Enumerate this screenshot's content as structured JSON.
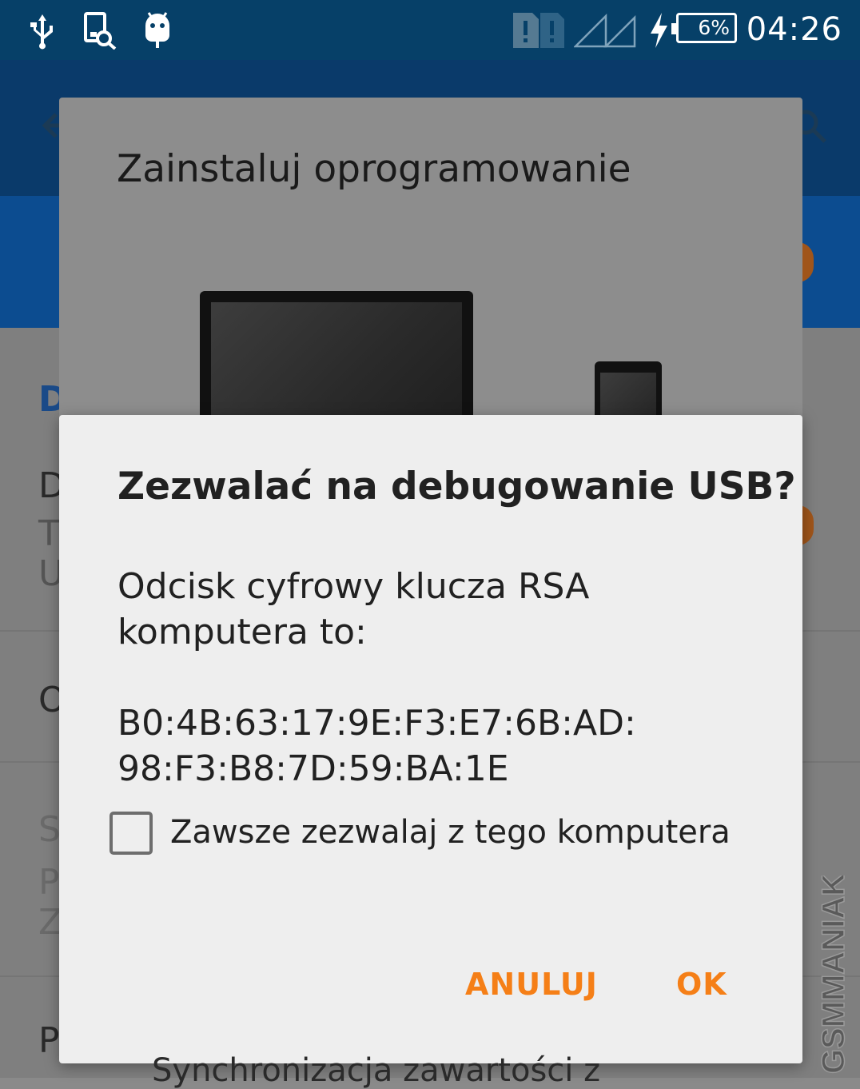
{
  "status_bar": {
    "left_icons": [
      "usb-debug-icon",
      "screenshot-search-icon",
      "android-debug-icon"
    ],
    "right_icons": [
      "sim-alert-icon",
      "signal-icon",
      "charging-icon"
    ],
    "battery_level": "6%",
    "time": "04:26"
  },
  "background_dialog": {
    "title": "Zainstaluj oprogramowanie"
  },
  "background_app": {
    "peek_letters": [
      "D",
      "D",
      "T",
      "U",
      "O",
      "S",
      "P",
      "Z",
      "P"
    ],
    "bottom_text": "Synchronizacja zawartości z"
  },
  "dialog": {
    "title": "Zezwalać na debugowanie USB?",
    "message_line1": "Odcisk cyfrowy klucza RSA",
    "message_line2": "komputera to:",
    "fingerprint_line1": "B0:4B:63:17:9E:F3:E7:6B:AD:",
    "fingerprint_line2": "98:F3:B8:7D:59:BA:1E",
    "checkbox_label": "Zawsze zezwalaj z tego komputera",
    "checkbox_checked": false,
    "cancel_label": "ANULUJ",
    "ok_label": "OK",
    "accent_color": "#f57f17"
  },
  "watermark": "GSMMANIAK"
}
